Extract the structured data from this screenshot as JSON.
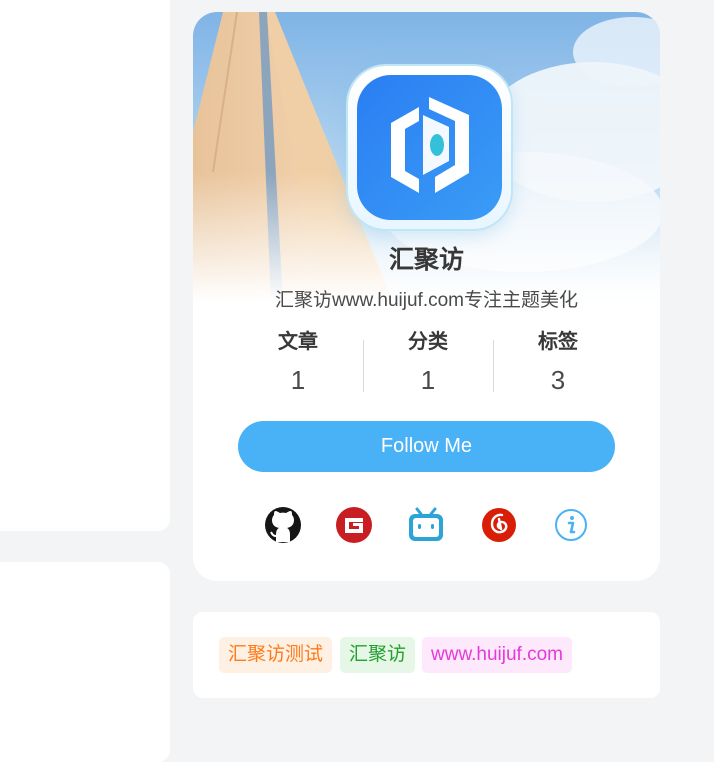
{
  "profile": {
    "name": "汇聚访",
    "description": "汇聚访www.huijuf.com专注主题美化",
    "stats": [
      {
        "label": "文章",
        "value": "1"
      },
      {
        "label": "分类",
        "value": "1"
      },
      {
        "label": "标签",
        "value": "3"
      }
    ],
    "follow_label": "Follow Me",
    "accent_color": "#49b1f5",
    "socials": [
      "github-icon",
      "gitee-icon",
      "bilibili-icon",
      "netease-music-icon",
      "info-icon"
    ]
  },
  "tags": [
    {
      "label": "汇聚访测试",
      "color": "#ff7a1a",
      "bg": "#fff0e4"
    },
    {
      "label": "汇聚访",
      "color": "#22a02e",
      "bg": "#e6f7e7"
    },
    {
      "label": "www.huijuf.com",
      "color": "#e43ad9",
      "bg": "#fde8fc"
    }
  ]
}
